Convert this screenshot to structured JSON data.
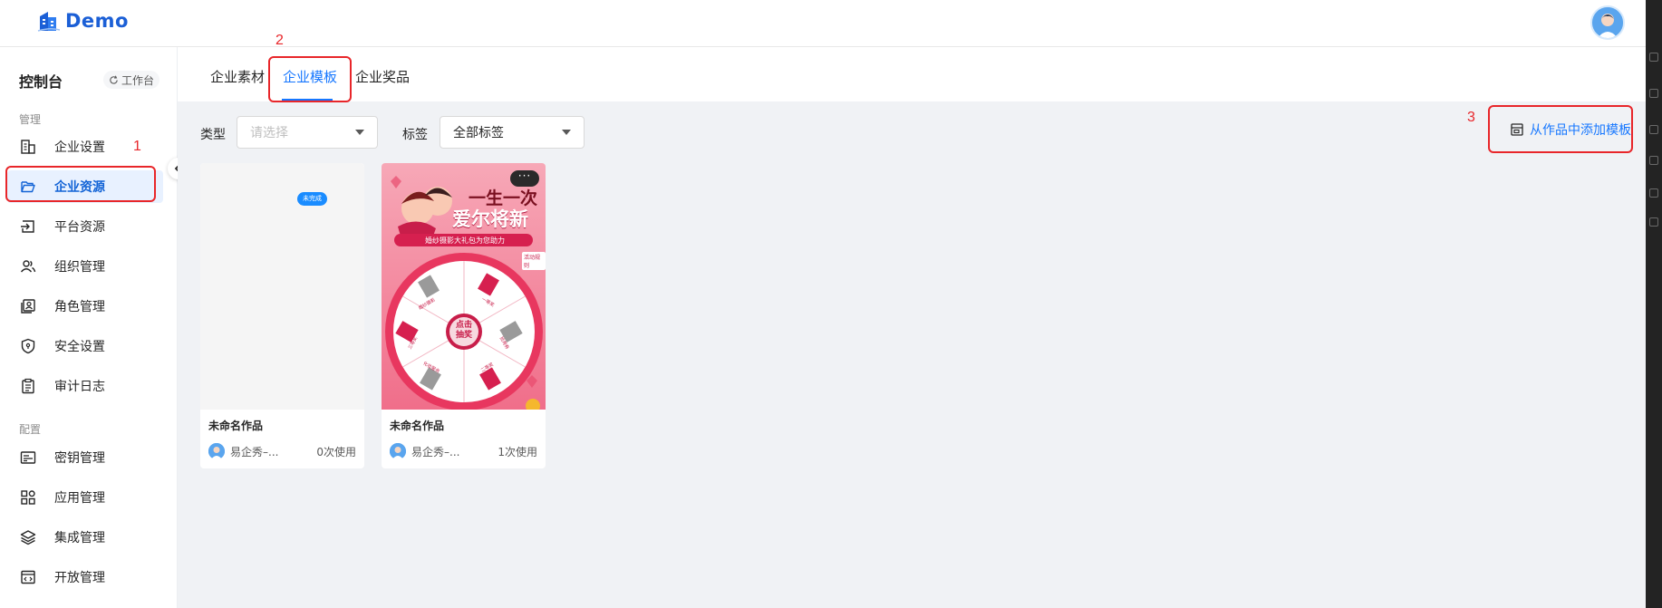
{
  "app": {
    "name": "Demo"
  },
  "sidebar": {
    "title": "控制台",
    "workbench_label": "工作台",
    "sections": {
      "manage": "管理",
      "config": "配置"
    },
    "items": [
      {
        "label": "企业设置",
        "icon": "building-icon"
      },
      {
        "label": "企业资源",
        "icon": "folder-open-icon",
        "active": true
      },
      {
        "label": "平台资源",
        "icon": "import-icon"
      },
      {
        "label": "组织管理",
        "icon": "users-icon"
      },
      {
        "label": "角色管理",
        "icon": "contact-card-icon"
      },
      {
        "label": "安全设置",
        "icon": "shield-icon"
      },
      {
        "label": "审计日志",
        "icon": "clipboard-icon"
      },
      {
        "label": "密钥管理",
        "icon": "id-card-icon"
      },
      {
        "label": "应用管理",
        "icon": "app-grid-icon"
      },
      {
        "label": "集成管理",
        "icon": "layers-icon"
      },
      {
        "label": "开放管理",
        "icon": "code-window-icon"
      }
    ]
  },
  "tabs": [
    {
      "label": "企业素材"
    },
    {
      "label": "企业模板",
      "active": true
    },
    {
      "label": "企业奖品"
    }
  ],
  "filters": {
    "type_label": "类型",
    "type_placeholder": "请选择",
    "tag_label": "标签",
    "tag_value": "全部标签"
  },
  "actions": {
    "add_from_works": "从作品中添加模板"
  },
  "cards": [
    {
      "title": "未命名作品",
      "author": "易企秀–...",
      "usage": "0次使用",
      "badge": "未完成"
    },
    {
      "title": "未命名作品",
      "author": "易企秀–...",
      "usage": "1次使用",
      "more": "···",
      "poster": {
        "headline1": "一生一次",
        "headline2": "爱尔将新",
        "subtitle": "婚纱摄影大礼包为您助力",
        "center_button": "点击抽奖",
        "corner_tag": "活动规则",
        "prizes": [
          "婚纱摄影",
          "一等奖",
          "抵用券",
          "二等奖",
          "三等奖",
          "化妆服务"
        ]
      }
    }
  ],
  "annotations": {
    "one": "1",
    "two": "2",
    "three": "3"
  },
  "colors": {
    "brand": "#1b5fd6",
    "accent": "#1677ff",
    "annotation": "#e8262a",
    "active_bg": "#e8f1ff"
  }
}
